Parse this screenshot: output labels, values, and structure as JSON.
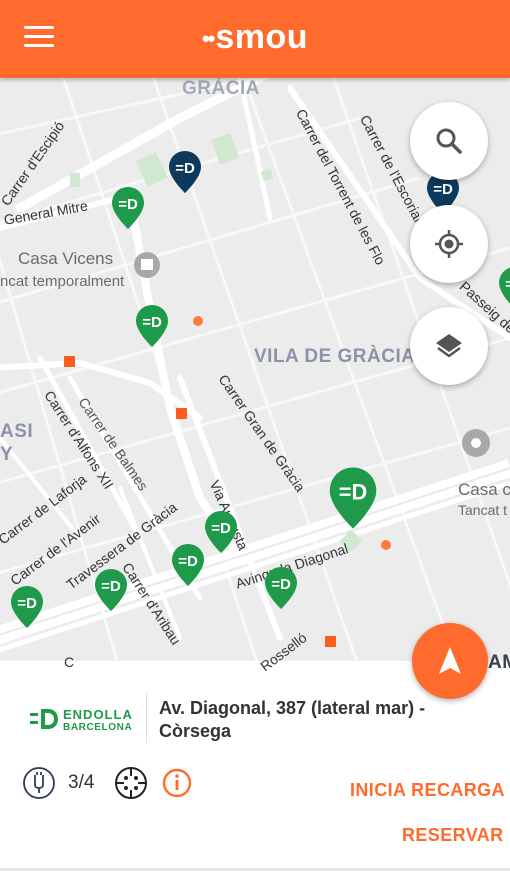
{
  "header": {
    "logo_dots": "••",
    "logo_text": "smou",
    "background": "#ff6b2c"
  },
  "map": {
    "district_top": "GRÀCIA",
    "district_main": "VILA DE GRÀCIA",
    "district_left_1": "ASI",
    "district_left_2": "Y",
    "district_right": "AM",
    "poi_casa_vicens_name": "Casa Vicens",
    "poi_casa_vicens_status": "ncat temporalment",
    "poi_right_name": "Casa c",
    "poi_right_status": "Tancat t",
    "streets": {
      "escipio": "Carrer d'Escipió",
      "general_mitre": "General Mitre",
      "torrent": "Carrer del Torrent de les Flo",
      "escorial": "Carrer de l'Escorial",
      "passeig": "Passeig de",
      "balmes": "Carrer de Balmes",
      "alfons": "Carrer d'Alfons XII",
      "gran_gracia": "Carrer Gran de Gràcia",
      "via_augusta": "Via Augusta",
      "laforja": "Carrer de Laforja",
      "avenir": "Carrer de l'Avenir",
      "travessera": "Travessera de Gràcia",
      "aribau": "Carrer d'Aribau",
      "diagonal": "Avinguda Diagonal",
      "rossello": "Rosselló",
      "carrer_c": "C"
    },
    "colors": {
      "marker_green": "#1e9a4a",
      "marker_blue": "#0d3a5c"
    }
  },
  "controls": {
    "search_icon": "search-icon",
    "locate_icon": "crosshair-icon",
    "layers_icon": "layers-icon",
    "navigate_icon": "navigation-arrow-icon"
  },
  "station": {
    "operator_line1": "ENDOLLA",
    "operator_line2": "BARCELONA",
    "address": "Av. Diagonal, 387 (lateral mar) - Còrsega",
    "availability": "3/4",
    "start_charge_label": "INICIA RECARGA",
    "reserve_label": "RESERVAR"
  }
}
